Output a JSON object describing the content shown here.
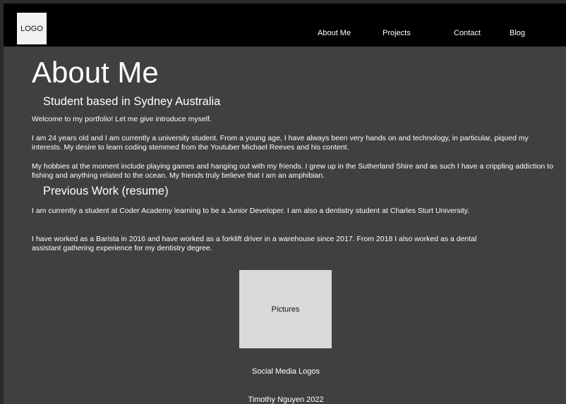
{
  "header": {
    "logo_label": "LOGO",
    "nav": [
      {
        "label": "About Me"
      },
      {
        "label": "Projects"
      },
      {
        "label": "Contact"
      },
      {
        "label": "Blog"
      }
    ]
  },
  "main": {
    "title": "About Me",
    "subtitle": "Student based in Sydney Australia",
    "intro_paragraphs": [
      "Welcome to my portfolio! Let me give introduce myself.",
      "I am 24 years old and I am currently a university student. From a young age, I have always been very hands on and technology, in particular, piqued my interests. My desire to learn coding stemmed from the Youtuber Michael Reeves and his content.",
      "My hobbies at the moment include playing games and hanging out with my friends. I grew up in the Sutherland Shire and as such I have a crippling addiction to fishing and anything related to the ocean. My friends truly believe that I am an amphibian."
    ],
    "previous_work_heading": "Previous Work (resume)",
    "work_paragraphs": [
      "I am currently a student at Coder Academy learning to be a Junior Developer. I am also a dentistry student at Charles Sturt University.",
      "I have worked as a Barista in 2016 and have worked as a forklift driver in a warehouse since 2017. From 2018 I also worked as a dental assistant gathering experience for my dentistry degree."
    ],
    "pictures_label": "Pictures"
  },
  "footer": {
    "social_label": "Social Media Logos",
    "credit": "Timothy Nguyen 2022"
  },
  "colors": {
    "navbar": "#000000",
    "page_background": "#404040",
    "outer_frame": "#2b2b2b",
    "placeholder_box": "#d9d9d9",
    "text": "#ffffff"
  }
}
